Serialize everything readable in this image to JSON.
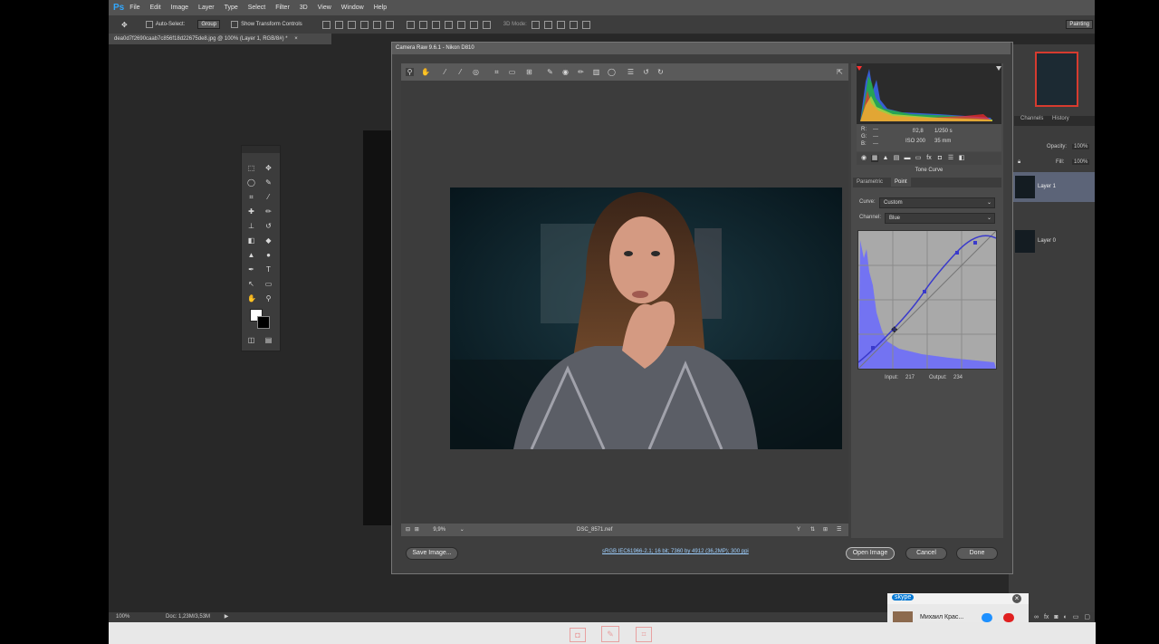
{
  "menubar": {
    "logo": "Ps",
    "items": [
      "File",
      "Edit",
      "Image",
      "Layer",
      "Type",
      "Select",
      "Filter",
      "3D",
      "View",
      "Window",
      "Help"
    ]
  },
  "options_bar": {
    "auto_select": "Auto-Select:",
    "group": "Group",
    "show_transform": "Show Transform Controls",
    "mode_3d": "3D Mode:",
    "workspace": "Painting"
  },
  "document": {
    "tab": "dea0d7f2690caab7c856f18d22675de8.jpg @ 100% (Layer 1, RGB/8#) *",
    "zoom": "100%",
    "doc_size": "Doc: 1,23M/3,53M"
  },
  "layers_panel": {
    "tabs": [
      "Channels",
      "History"
    ],
    "opacity_label": "Opacity:",
    "opacity_value": "100%",
    "fill_label": "Fill:",
    "fill_value": "100%",
    "layers": [
      "Layer 1",
      "Layer 0"
    ]
  },
  "camera_raw": {
    "title": "Camera Raw 9.6.1  -  Nikon D810",
    "info": {
      "r": "R:",
      "g": "G:",
      "b": "B:",
      "dashes": "---",
      "aperture": "f/2,8",
      "shutter": "1/250 s",
      "iso": "ISO 200",
      "focal": "35 mm"
    },
    "panel_title": "Tone Curve",
    "tabs": [
      "Parametric",
      "Point"
    ],
    "curve_label": "Curve:",
    "curve_value": "Custom",
    "channel_label": "Channel:",
    "channel_value": "Blue",
    "input_label": "Input:",
    "input_value": "217",
    "output_label": "Output:",
    "output_value": "234",
    "zoom": "9,9%",
    "filename": "DSC_8571.nef",
    "workflow_link": "sRGB IEC61966-2.1; 16 bit; 7360 by 4912 (36,2MP); 300 ppi",
    "buttons": {
      "save": "Save Image...",
      "open": "Open Image",
      "cancel": "Cancel",
      "done": "Done"
    }
  },
  "skype": {
    "logo": "skype",
    "contact": "Михаил Крас..."
  },
  "colors": {
    "accent_blue": "#31a8ff",
    "curve_blue": "#3a3acb",
    "highlight_red": "#d63b2f"
  }
}
